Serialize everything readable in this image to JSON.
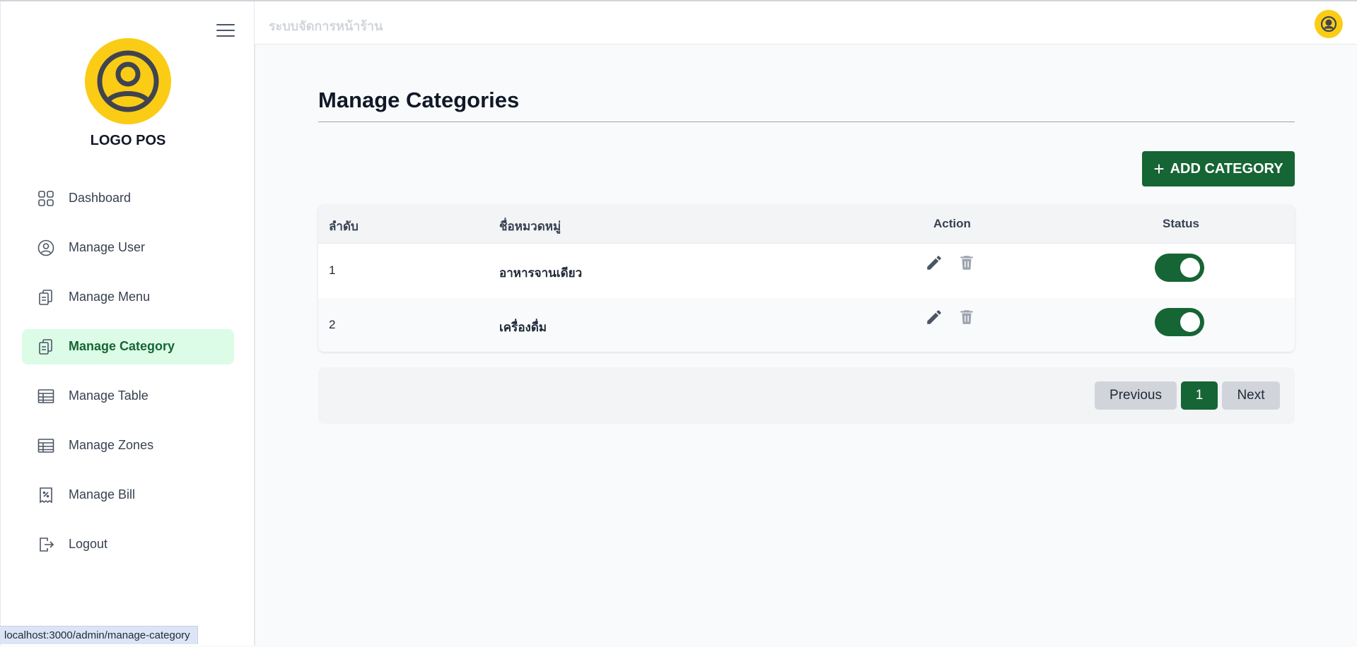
{
  "sidebar": {
    "logo_text": "LOGO POS",
    "items": [
      {
        "label": "Dashboard",
        "icon": "grid-icon"
      },
      {
        "label": "Manage User",
        "icon": "user-circle-icon"
      },
      {
        "label": "Manage Menu",
        "icon": "clipboard-icon"
      },
      {
        "label": "Manage Category",
        "icon": "clipboard-icon",
        "active": true
      },
      {
        "label": "Manage Table",
        "icon": "table-icon"
      },
      {
        "label": "Manage Zones",
        "icon": "table-icon"
      },
      {
        "label": "Manage Bill",
        "icon": "receipt-icon"
      },
      {
        "label": "Logout",
        "icon": "logout-icon"
      }
    ]
  },
  "header": {
    "title": "ระบบจัดการหน้าร้าน"
  },
  "main": {
    "title": "Manage Categories",
    "add_button": "ADD CATEGORY",
    "table": {
      "columns": [
        "ลำดับ",
        "ชื่อหมวดหมู่",
        "Action",
        "Status"
      ],
      "rows": [
        {
          "index": "1",
          "name": "อาหารจานเดียว",
          "status": true
        },
        {
          "index": "2",
          "name": "เครื่องดื่ม",
          "status": true
        }
      ]
    },
    "pagination": {
      "previous": "Previous",
      "current": "1",
      "next": "Next"
    }
  },
  "status_bar": {
    "url": "localhost:3000/admin/manage-category"
  },
  "colors": {
    "accent": "#166534",
    "active_bg": "#dcfce7",
    "logo": "#facc15"
  }
}
